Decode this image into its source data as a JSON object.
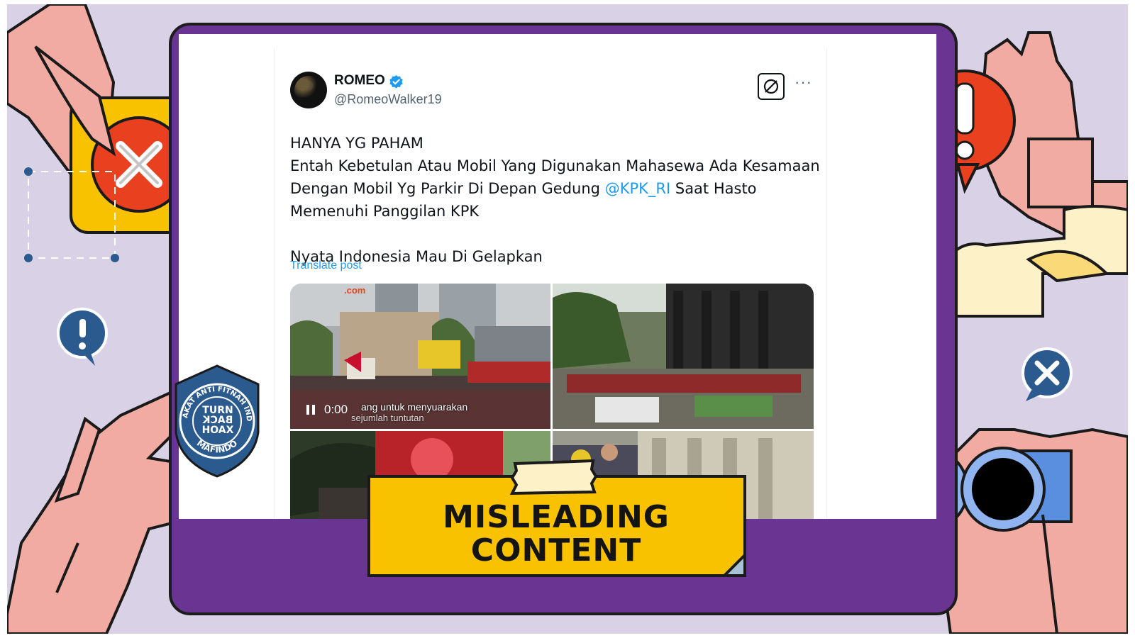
{
  "tweet": {
    "display_name": "ROMEO",
    "handle": "@RomeoWalker19",
    "verified_icon": "verified-badge-icon",
    "lines": {
      "l1": "HANYA YG PAHAM",
      "l2": "Entah Kebetulan Atau Mobil Yang Digunakan Mahasewa Ada Kesamaan",
      "l3_pre": "Dengan Mobil Yg Parkir Di Depan Gedung ",
      "l3_mention": "@KPK_RI",
      "l3_post": " Saat Hasto",
      "l4": "Memenuhi Panggilan KPK",
      "l5": "Nyata Indonesia Mau Di Gelapkan"
    },
    "translate_label": "Translate post",
    "more_label": "···",
    "video_time": "0:00",
    "video_caption_1": "ang untuk menyuarakan",
    "video_caption_2": "sejumlah tuntutan",
    "watermark": ".com"
  },
  "badge": {
    "line1": "MISLEADING",
    "line2": "CONTENT"
  },
  "mafindo": {
    "ring_text": "MASYARAKAT ANTI FITNAH INDONESIA",
    "bottom_text": "MAFINDO",
    "turn": "TURN",
    "back": "BACK",
    "hoax": "HOAX"
  },
  "colors": {
    "background": "#d9d2e6",
    "tablet": "#6a3592",
    "badge": "#f9c200",
    "alert_red": "#e9401f",
    "shield": "#2b5a8e",
    "link": "#1d9bf0"
  }
}
